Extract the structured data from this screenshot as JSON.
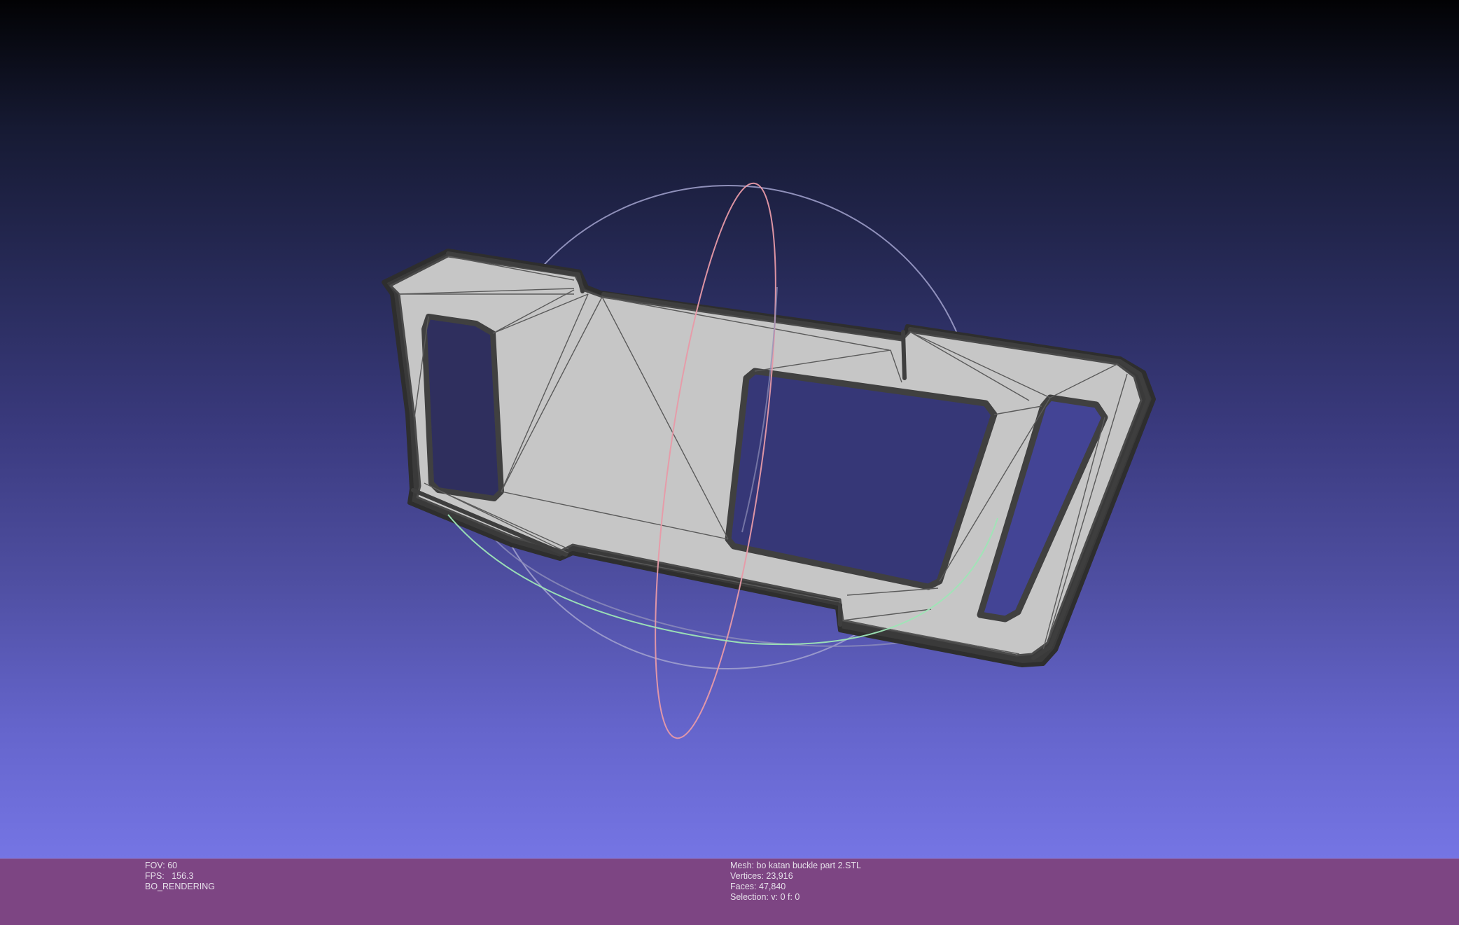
{
  "viewer": {
    "fov_label": "FOV:",
    "fov_value": "60",
    "fps_label": "FPS:",
    "fps_value": "156.3",
    "render_mode": "BO_RENDERING"
  },
  "mesh_info": {
    "mesh_label": "Mesh:",
    "mesh_name": "bo katan buckle part 2.STL",
    "vertices_label": "Vertices:",
    "vertices_value": "23,916",
    "faces_label": "Faces:",
    "faces_value": "47,840",
    "selection_label": "Selection:",
    "selection_value": "v: 0 f: 0"
  },
  "colors": {
    "background_top": "#020204",
    "background_bottom": "#7575e4",
    "info_bar": "#7d4583",
    "mesh_fill": "#c6c6c6",
    "mesh_edge": "#3c3c3c",
    "trackball_x": "#e89aa8",
    "trackball_y": "#9ee6b6",
    "trackball_z": "#a6a6d2"
  },
  "icons": [
    "trackball-gizmo"
  ]
}
